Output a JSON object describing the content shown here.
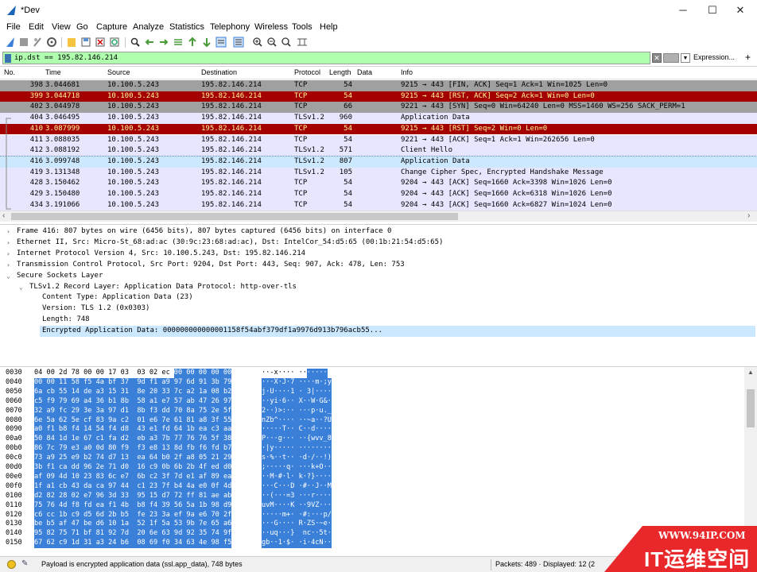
{
  "window": {
    "title": "*Dev",
    "minimize": "─",
    "maximize": "☐",
    "close": "✕"
  },
  "menu": [
    "File",
    "Edit",
    "View",
    "Go",
    "Capture",
    "Analyze",
    "Statistics",
    "Telephony",
    "Wireless",
    "Tools",
    "Help"
  ],
  "filter": {
    "value": "ip.dst == 195.82.146.214",
    "expression_label": "Expression...",
    "plus": "+"
  },
  "packet_list": {
    "columns": [
      "No.",
      "Time",
      "Source",
      "Destination",
      "Protocol",
      "Length",
      "Data",
      "Info"
    ],
    "rows": [
      {
        "no": "398",
        "time": "3.044681",
        "src": "10.100.5.243",
        "dst": "195.82.146.214",
        "proto": "TCP",
        "len": "54",
        "info": "9215 → 443 [FIN, ACK] Seq=1 Ack=1 Win=1025 Len=0",
        "bg": "#a0a0a0",
        "fg": "#000000"
      },
      {
        "no": "399",
        "time": "3.044718",
        "src": "10.100.5.243",
        "dst": "195.82.146.214",
        "proto": "TCP",
        "len": "54",
        "info": "9215 → 443 [RST, ACK] Seq=2 Ack=1 Win=0 Len=0",
        "bg": "#a40000",
        "fg": "#fffc9c"
      },
      {
        "no": "402",
        "time": "3.044978",
        "src": "10.100.5.243",
        "dst": "195.82.146.214",
        "proto": "TCP",
        "len": "66",
        "info": "9221 → 443 [SYN] Seq=0 Win=64240 Len=0 MSS=1460 WS=256 SACK_PERM=1",
        "bg": "#a0a0a0",
        "fg": "#000000"
      },
      {
        "no": "404",
        "time": "3.046495",
        "src": "10.100.5.243",
        "dst": "195.82.146.214",
        "proto": "TLSv1.2",
        "len": "960",
        "info": "Application Data",
        "bg": "#e7e6ff",
        "fg": "#000000"
      },
      {
        "no": "410",
        "time": "3.087999",
        "src": "10.100.5.243",
        "dst": "195.82.146.214",
        "proto": "TCP",
        "len": "54",
        "info": "9215 → 443 [RST] Seq=2 Win=0 Len=0",
        "bg": "#a40000",
        "fg": "#fffc9c"
      },
      {
        "no": "411",
        "time": "3.088035",
        "src": "10.100.5.243",
        "dst": "195.82.146.214",
        "proto": "TCP",
        "len": "54",
        "info": "9221 → 443 [ACK] Seq=1 Ack=1 Win=262656 Len=0",
        "bg": "#e7e6ff",
        "fg": "#000000"
      },
      {
        "no": "412",
        "time": "3.088192",
        "src": "10.100.5.243",
        "dst": "195.82.146.214",
        "proto": "TLSv1.2",
        "len": "571",
        "info": "Client Hello",
        "bg": "#e7e6ff",
        "fg": "#000000"
      },
      {
        "no": "416",
        "time": "3.099748",
        "src": "10.100.5.243",
        "dst": "195.82.146.214",
        "proto": "TLSv1.2",
        "len": "807",
        "info": "Application Data",
        "bg": "#e7e6ff",
        "fg": "#000000",
        "selected": true
      },
      {
        "no": "419",
        "time": "3.131348",
        "src": "10.100.5.243",
        "dst": "195.82.146.214",
        "proto": "TLSv1.2",
        "len": "105",
        "info": "Change Cipher Spec, Encrypted Handshake Message",
        "bg": "#e7e6ff",
        "fg": "#000000"
      },
      {
        "no": "428",
        "time": "3.150462",
        "src": "10.100.5.243",
        "dst": "195.82.146.214",
        "proto": "TCP",
        "len": "54",
        "info": "9204 → 443 [ACK] Seq=1660 Ack=3398 Win=1026 Len=0",
        "bg": "#e7e6ff",
        "fg": "#000000"
      },
      {
        "no": "429",
        "time": "3.150480",
        "src": "10.100.5.243",
        "dst": "195.82.146.214",
        "proto": "TCP",
        "len": "54",
        "info": "9204 → 443 [ACK] Seq=1660 Ack=6318 Win=1026 Len=0",
        "bg": "#e7e6ff",
        "fg": "#000000"
      },
      {
        "no": "434",
        "time": "3.191066",
        "src": "10.100.5.243",
        "dst": "195.82.146.214",
        "proto": "TCP",
        "len": "54",
        "info": "9204 → 443 [ACK] Seq=1660 Ack=6827 Win=1024 Len=0",
        "bg": "#e7e6ff",
        "fg": "#000000"
      }
    ]
  },
  "details": [
    {
      "arrow": ">",
      "text": "Frame 416: 807 bytes on wire (6456 bits), 807 bytes captured (6456 bits) on interface 0",
      "indent": 0
    },
    {
      "arrow": ">",
      "text": "Ethernet II, Src: Micro-St_68:ad:ac (30:9c:23:68:ad:ac), Dst: IntelCor_54:d5:65 (00:1b:21:54:d5:65)",
      "indent": 0
    },
    {
      "arrow": ">",
      "text": "Internet Protocol Version 4, Src: 10.100.5.243, Dst: 195.82.146.214",
      "indent": 0
    },
    {
      "arrow": ">",
      "text": "Transmission Control Protocol, Src Port: 9204, Dst Port: 443, Seq: 907, Ack: 478, Len: 753",
      "indent": 0
    },
    {
      "arrow": "v",
      "text": "Secure Sockets Layer",
      "indent": 0
    },
    {
      "arrow": "v",
      "text": "TLSv1.2 Record Layer: Application Data Protocol: http-over-tls",
      "indent": 1
    },
    {
      "arrow": "",
      "text": "Content Type: Application Data (23)",
      "indent": 2
    },
    {
      "arrow": "",
      "text": "Version: TLS 1.2 (0x0303)",
      "indent": 2
    },
    {
      "arrow": "",
      "text": "Length: 748",
      "indent": 2
    },
    {
      "arrow": "",
      "text": "Encrypted Application Data: 000000000000001158f54abf379df1a9976d913b796acb55...",
      "indent": 2,
      "selected": true
    }
  ],
  "hex": [
    {
      "off": "0030",
      "hexn": "04 00 2d 78 00 00 17 03  03 02 ec ",
      "hexs": "00 00 00 00 00",
      "ascn": "··-x···· ··",
      "ascs": "·····"
    },
    {
      "off": "0040",
      "hexn": "",
      "hexs": "00 00 11 58 f5 4a bf 37  9d f1 a9 97 6d 91 3b 79",
      "ascn": "",
      "ascs": "···X·J·7 ····m·;y"
    },
    {
      "off": "0050",
      "hexn": "",
      "hexs": "6a cb 55 14 de a3 15 31  8e 20 33 7c a2 1a 08 b2",
      "ascn": "",
      "ascs": "j·U····1 · 3|····"
    },
    {
      "off": "0060",
      "hexn": "",
      "hexs": "c5 f9 79 69 a4 36 b1 8b  58 a1 e7 57 ab 47 26 97",
      "ascn": "",
      "ascs": "··yi·6·· X··W·G&·"
    },
    {
      "off": "0070",
      "hexn": "",
      "hexs": "32 a9 fc 29 3e 3a 97 d1  8b f3 dd 70 8a 75 2e 5f",
      "ascn": "",
      "ascs": "2··)>:·· ···p·u._"
    },
    {
      "off": "0080",
      "hexn": "",
      "hexs": "6e 5a 62 5e cf 83 9a c2  01 e6 7e 61 81 a8 3f 55",
      "ascn": "",
      "ascs": "nZb^···· ··~a··?U"
    },
    {
      "off": "0090",
      "hexn": "",
      "hexs": "a0 f1 b8 f4 14 54 f4 d8  43 e1 fd 64 1b ea c3 aa",
      "ascn": "",
      "ascs": "·····T·· C··d····"
    },
    {
      "off": "00a0",
      "hexn": "",
      "hexs": "50 84 1d 1e 67 c1 fa d2  eb a3 7b 77 76 76 5f 38",
      "ascn": "",
      "ascs": "P···g··· ··{wvv_8"
    },
    {
      "off": "00b0",
      "hexn": "",
      "hexs": "86 7c 79 e3 a0 0d 80 f9  f3 e8 13 8d fb f6 fd b7",
      "ascn": "",
      "ascs": "·|y····· ········"
    },
    {
      "off": "00c0",
      "hexn": "",
      "hexs": "73 a9 25 e9 b2 74 d7 13  ea 64 b0 2f a8 05 21 29",
      "ascn": "",
      "ascs": "s·%··t·· ·d·/··!)"
    },
    {
      "off": "00d0",
      "hexn": "",
      "hexs": "3b f1 ca dd 96 2e 71 d0  16 c9 0b 6b 2b 4f ed d0",
      "ascn": "",
      "ascs": ";·····q· ···k+O··"
    },
    {
      "off": "00e0",
      "hexn": "",
      "hexs": "af 09 4d 10 23 83 6c e7  6b c2 3f 7d e1 af 89 ea",
      "ascn": "",
      "ascs": "··M·#·l· k·?}····"
    },
    {
      "off": "00f0",
      "hexn": "",
      "hexs": "1f a1 cb 43 da ca 97 44  c1 23 7f b4 4a e0 0f 4d",
      "ascn": "",
      "ascs": "···C···D ·#··J··M"
    },
    {
      "off": "0100",
      "hexn": "",
      "hexs": "d2 82 28 02 e7 96 3d 33  95 15 d7 72 ff 81 ae ab",
      "ascn": "",
      "ascs": "··(···=3 ···r····"
    },
    {
      "off": "0110",
      "hexn": "",
      "hexs": "75 76 4d f8 fd ea f1 4b  b8 f4 39 56 5a 1b 98 d9",
      "ascn": "",
      "ascs": "uvM····K ··9VZ···"
    },
    {
      "off": "0120",
      "hexn": "",
      "hexs": "c6 cc 1b c9 d5 6d 2b b5  fe 23 3a ef 9a e6 70 2f",
      "ascn": "",
      "ascs": "·····m+· ·#:···p/"
    },
    {
      "off": "0130",
      "hexn": "",
      "hexs": "be b5 af 47 be d6 10 1a  52 1f 5a 53 9b 7e 65 a6",
      "ascn": "",
      "ascs": "···G···· R·ZS·~e·"
    },
    {
      "off": "0140",
      "hexn": "",
      "hexs": "95 82 75 71 bf 81 92 7d  20 6e 63 9d 92 35 74 9f",
      "ascn": "",
      "ascs": "··uq···}  nc··5t·"
    },
    {
      "off": "0150",
      "hexn": "",
      "hexs": "67 62 c9 1d 31 a3 24 b6  08 69 f0 34 63 4e 98 f5",
      "ascn": "",
      "ascs": "gb··1·$· ·i·4cN··"
    }
  ],
  "status": {
    "message": "Payload is encrypted application data (ssl.app_data), 748 bytes",
    "packets": "Packets: 489 · Displayed: 12 (2"
  },
  "watermark": {
    "url": "WWW.94IP.COM",
    "brand": "IT运维空间"
  },
  "colors": {
    "selected_row": "#cce8ff",
    "hex_selection": "#3a7fd8",
    "filter_ok": "#afffaf",
    "rst_row": "#a40000",
    "gray_row": "#a0a0a0",
    "tls_row": "#e7e6ff",
    "watermark": "#e8282a"
  }
}
